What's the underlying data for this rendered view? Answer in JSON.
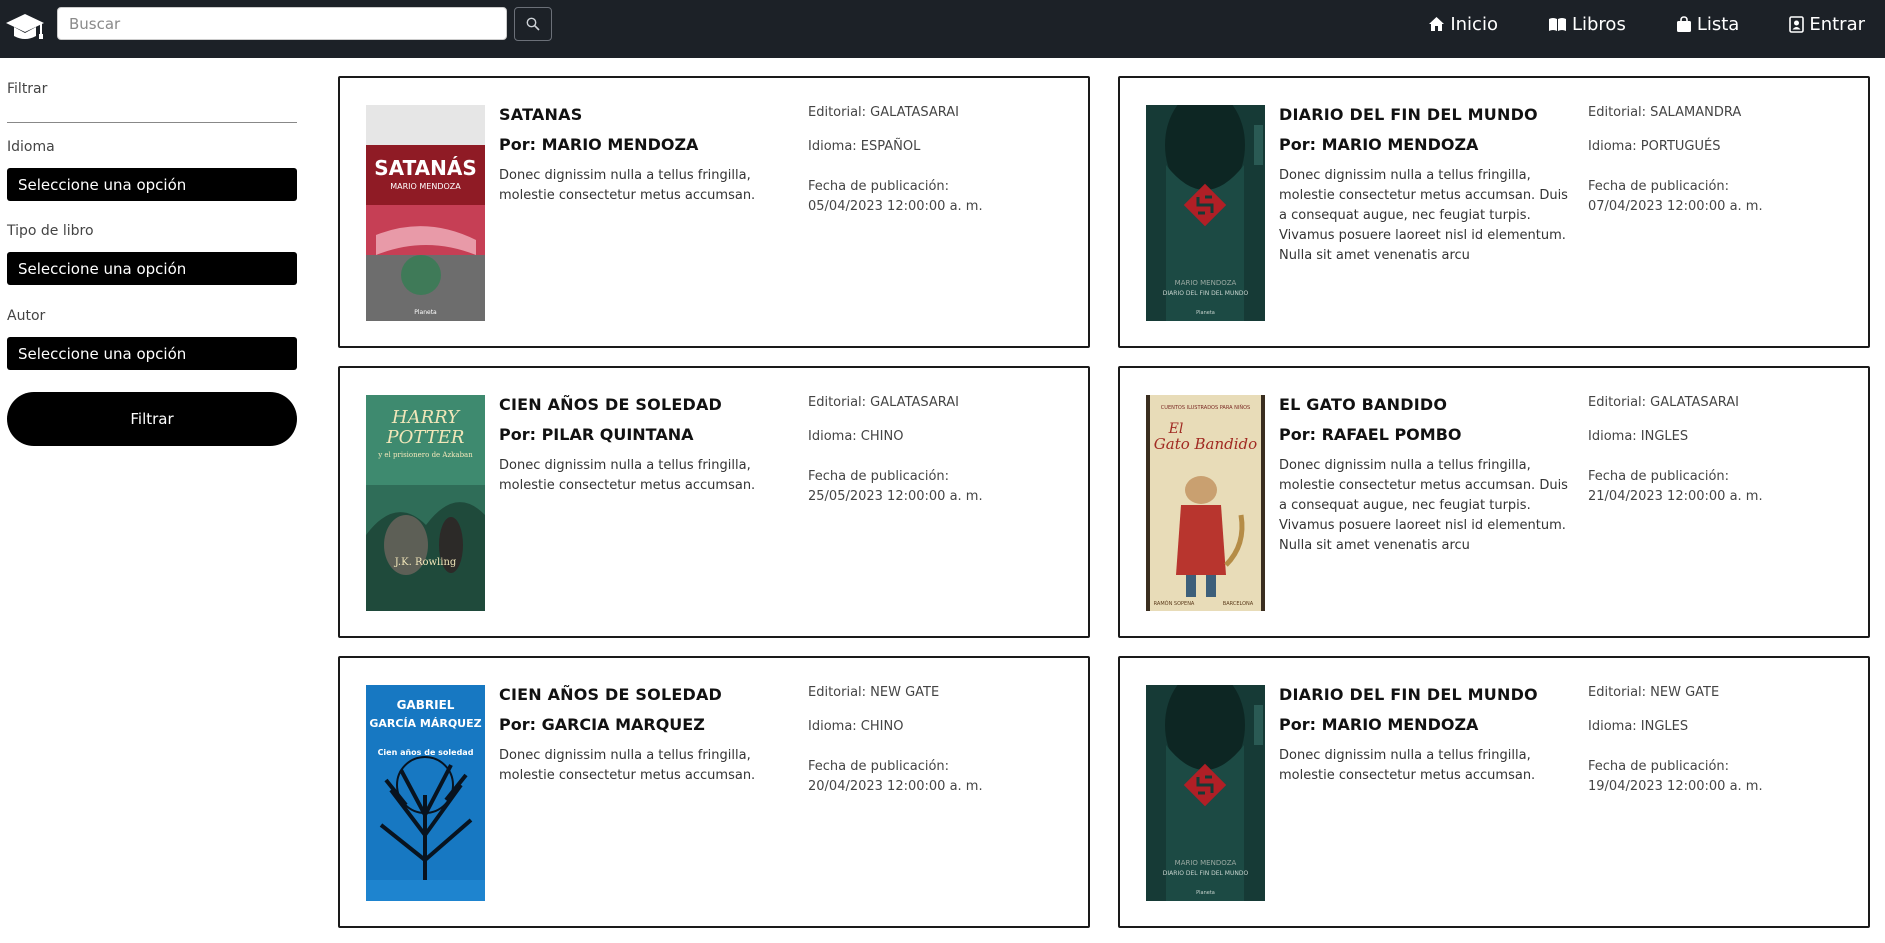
{
  "nav": {
    "search_placeholder": "Buscar",
    "links": [
      {
        "label": "Inicio",
        "icon": "home-icon"
      },
      {
        "label": "Libros",
        "icon": "book-icon"
      },
      {
        "label": "Lista",
        "icon": "shopping-bag-icon"
      },
      {
        "label": "Entrar",
        "icon": "user-badge-icon"
      }
    ]
  },
  "sidebar": {
    "title": "Filtrar",
    "fields": [
      {
        "label": "Idioma",
        "value": "Seleccione una opción"
      },
      {
        "label": "Tipo de libro",
        "value": "Seleccione una opción"
      },
      {
        "label": "Autor",
        "value": "Seleccione una opción"
      }
    ],
    "filter_button": "Filtrar"
  },
  "books": [
    {
      "title": "SATANAS",
      "author": "Por: MARIO MENDOZA",
      "description": "Donec dignissim nulla a tellus fringilla, molestie consectetur metus accumsan.",
      "editorial": "Editorial: GALATASARAI",
      "language": "Idioma: ESPAÑOL",
      "date_label": "Fecha de publicación:",
      "date": "05/04/2023 12:00:00 a. m.",
      "cover_text": [
        "SATANÁS",
        "MARIO MENDOZA",
        "Planeta"
      ]
    },
    {
      "title": "DIARIO DEL FIN DEL MUNDO",
      "author": "Por: MARIO MENDOZA",
      "description": "Donec dignissim nulla a tellus fringilla, molestie consectetur metus accumsan. Duis a consequat augue, nec feugiat turpis. Vivamus posuere laoreet nisl id elementum. Nulla sit amet venenatis arcu",
      "editorial": "Editorial: SALAMANDRA",
      "language": "Idioma: PORTUGUÉS",
      "date_label": "Fecha de publicación:",
      "date": "07/04/2023 12:00:00 a. m.",
      "cover_text": [
        "MARIO MENDOZA",
        "DIARIO DEL FIN DEL MUNDO",
        "Planeta"
      ]
    },
    {
      "title": "CIEN AÑOS DE SOLEDAD",
      "author": "Por: PILAR QUINTANA",
      "description": "Donec dignissim nulla a tellus fringilla, molestie consectetur metus accumsan.",
      "editorial": "Editorial: GALATASARAI",
      "language": "Idioma: CHINO",
      "date_label": "Fecha de publicación:",
      "date": "25/05/2023 12:00:00 a. m.",
      "cover_text": [
        "HARRY",
        "POTTER",
        "y el prisionero de Azkaban",
        "J.K. Rowling"
      ]
    },
    {
      "title": "EL GATO BANDIDO",
      "author": "Por: RAFAEL POMBO",
      "description": "Donec dignissim nulla a tellus fringilla, molestie consectetur metus accumsan. Duis a consequat augue, nec feugiat turpis. Vivamus posuere laoreet nisl id elementum. Nulla sit amet venenatis arcu",
      "editorial": "Editorial: GALATASARAI",
      "language": "Idioma: INGLES",
      "date_label": "Fecha de publicación:",
      "date": "21/04/2023 12:00:00 a. m.",
      "cover_text": [
        "CUENTOS ILUSTRADOS PARA NIÑOS",
        "El",
        "Gato Bandido",
        "RAMÓN SOPENA",
        "BARCELONA"
      ]
    },
    {
      "title": "CIEN AÑOS DE SOLEDAD",
      "author": "Por: GARCIA MARQUEZ",
      "description": "Donec dignissim nulla a tellus fringilla, molestie consectetur metus accumsan.",
      "editorial": "Editorial: NEW GATE",
      "language": "Idioma: CHINO",
      "date_label": "Fecha de publicación:",
      "date": "20/04/2023 12:00:00 a. m.",
      "cover_text": [
        "GABRIEL",
        "GARCÍA MÁRQUEZ",
        "Cien años de soledad"
      ]
    },
    {
      "title": "DIARIO DEL FIN DEL MUNDO",
      "author": "Por: MARIO MENDOZA",
      "description": "Donec dignissim nulla a tellus fringilla, molestie consectetur metus accumsan.",
      "editorial": "Editorial: NEW GATE",
      "language": "Idioma: INGLES",
      "date_label": "Fecha de publicación:",
      "date": "19/04/2023 12:00:00 a. m.",
      "cover_text": [
        "MARIO MENDOZA",
        "DIARIO DEL FIN DEL MUNDO",
        "Planeta"
      ]
    }
  ],
  "colors": {
    "navbar": "#1c2127",
    "select_bg": "#000000",
    "card_border": "#1a1a1a"
  }
}
